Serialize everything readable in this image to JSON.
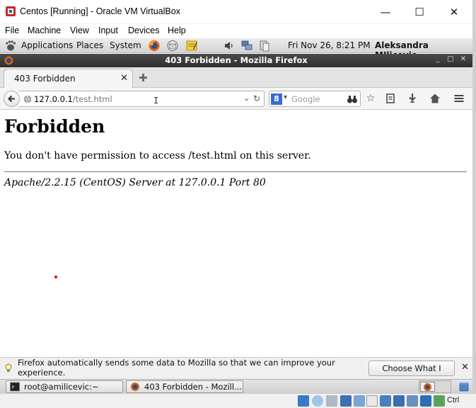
{
  "vbox": {
    "title": "Centos [Running] - Oracle VM VirtualBox",
    "menu": [
      "File",
      "Machine",
      "View",
      "Input",
      "Devices",
      "Help"
    ],
    "host_key_label": "Ctrl"
  },
  "gnome_panel": {
    "menus": [
      "Applications",
      "Places",
      "System"
    ],
    "clock": "Fri Nov 26,  8:21 PM",
    "user": "Aleksandra MIlicevic"
  },
  "firefox": {
    "window_title": "403 Forbidden - Mozilla Firefox",
    "tab_title": "403 Forbidden",
    "url_host": "127.0.0.1",
    "url_path": "/test.html",
    "search_placeholder": "Google"
  },
  "page": {
    "heading": "Forbidden",
    "message": "You don't have permission to access /test.html on this server.",
    "address": "Apache/2.2.15 (CentOS) Server at 127.0.0.1 Port 80"
  },
  "notification": {
    "text": "Firefox automatically sends some data to Mozilla so that we can improve your experience.",
    "button": "Choose What I Share"
  },
  "taskbar": {
    "items": [
      "root@amilicevic:~",
      "403 Forbidden - Mozill..."
    ]
  },
  "colors": {
    "accent_red": "#e00000",
    "titlebar_dark": "#3a3a3a",
    "search_engine_blue": "#3a6bd1"
  }
}
